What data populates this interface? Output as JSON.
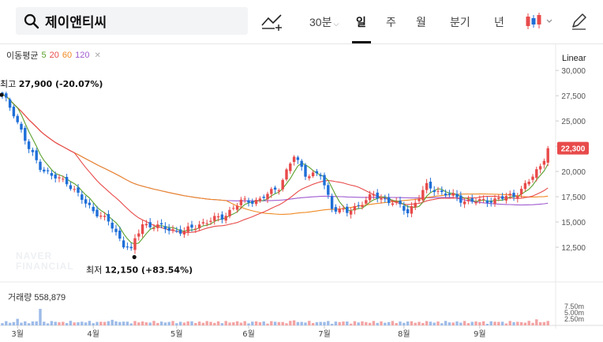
{
  "search": {
    "query": "제이앤티씨"
  },
  "periods": [
    {
      "label": "30분",
      "has_caret": true,
      "active": false
    },
    {
      "label": "일",
      "active": true
    },
    {
      "label": "주",
      "active": false
    },
    {
      "label": "월",
      "active": false
    },
    {
      "label": "분기",
      "active": false
    },
    {
      "label": "년",
      "active": false
    }
  ],
  "ma_legend": {
    "title": "이동평균",
    "items": [
      {
        "label": "5",
        "color": "#5aa02c"
      },
      {
        "label": "20",
        "color": "#e84a4a"
      },
      {
        "label": "60",
        "color": "#f08a24"
      },
      {
        "label": "120",
        "color": "#a05bd0"
      }
    ]
  },
  "scale_mode": "Linear",
  "volume_label": "거래량 558,879",
  "watermark": [
    "NAVER",
    "FINANCIAL"
  ],
  "colors": {
    "up": "#e84a4a",
    "down": "#1f6fd8",
    "accent": "#e84a4a"
  },
  "chart_data": {
    "type": "candlestick",
    "y_axis": {
      "min": 10000,
      "max": 31500,
      "ticks": [
        12500,
        15000,
        17500,
        20000,
        22500,
        25000,
        27500,
        30000
      ]
    },
    "y_tick_labels": [
      "12,500",
      "15,000",
      "17,500",
      "20,000",
      "22,500",
      "25,000",
      "27,500",
      "30,000"
    ],
    "x_month_labels": [
      "3월",
      "4월",
      "5월",
      "6월",
      "7월",
      "8월",
      "9월"
    ],
    "x_month_index": [
      4,
      24,
      46,
      65,
      85,
      106,
      126
    ],
    "high_annotation": {
      "label": "최고",
      "value": "27,900 (-20.07%)",
      "index": 0,
      "price": 27900
    },
    "low_annotation": {
      "label": "최저",
      "value": "12,150 (+83.54%)",
      "index": 34,
      "price": 12150
    },
    "last_price": {
      "label": "22,300",
      "value": 22300
    },
    "close_anchors": [
      [
        0,
        27600
      ],
      [
        3,
        25800
      ],
      [
        7,
        22200
      ],
      [
        10,
        20500
      ],
      [
        13,
        19500
      ],
      [
        17,
        19000
      ],
      [
        22,
        16800
      ],
      [
        28,
        15000
      ],
      [
        32,
        12800
      ],
      [
        34,
        12400
      ],
      [
        37,
        14800
      ],
      [
        40,
        14600
      ],
      [
        48,
        14000
      ],
      [
        52,
        14800
      ],
      [
        58,
        15500
      ],
      [
        63,
        17000
      ],
      [
        68,
        17200
      ],
      [
        73,
        18500
      ],
      [
        77,
        21500
      ],
      [
        80,
        19800
      ],
      [
        84,
        19600
      ],
      [
        87,
        16500
      ],
      [
        91,
        15900
      ],
      [
        95,
        17000
      ],
      [
        98,
        17600
      ],
      [
        103,
        17000
      ],
      [
        107,
        16000
      ],
      [
        112,
        18500
      ],
      [
        117,
        17800
      ],
      [
        121,
        17200
      ],
      [
        126,
        17000
      ],
      [
        131,
        17300
      ],
      [
        135,
        17600
      ],
      [
        139,
        19000
      ],
      [
        142,
        20500
      ],
      [
        144,
        22300
      ]
    ],
    "volume_axis": {
      "labels": [
        "7.50m",
        "5.00m",
        "2.50m"
      ],
      "values": [
        7.5,
        5.0,
        2.5
      ],
      "max": 9
    }
  }
}
